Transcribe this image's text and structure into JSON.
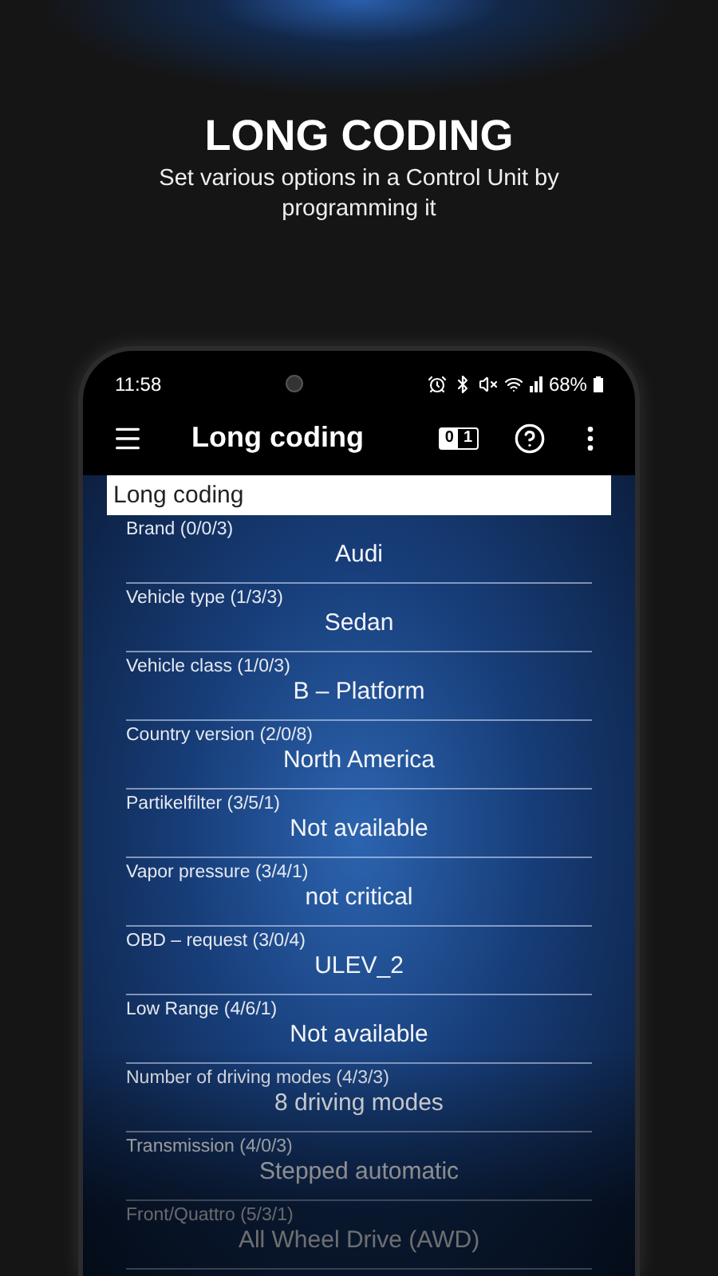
{
  "promo": {
    "title": "LONG CODING",
    "subtitle": "Set various options in a Control Unit by programming it"
  },
  "status_bar": {
    "time": "11:58",
    "battery": "68%"
  },
  "app_bar": {
    "title": "Long coding",
    "toggle_digits": [
      "0",
      "1"
    ]
  },
  "section": {
    "title": "Long coding"
  },
  "rows": [
    {
      "label": "Brand (0/0/3)",
      "value": "Audi"
    },
    {
      "label": "Vehicle type (1/3/3)",
      "value": "Sedan"
    },
    {
      "label": "Vehicle class (1/0/3)",
      "value": "B – Platform"
    },
    {
      "label": "Country version (2/0/8)",
      "value": "North America"
    },
    {
      "label": "Partikelfilter (3/5/1)",
      "value": "Not available"
    },
    {
      "label": "Vapor pressure (3/4/1)",
      "value": "not critical"
    },
    {
      "label": "OBD – request (3/0/4)",
      "value": "ULEV_2"
    },
    {
      "label": "Low Range (4/6/1)",
      "value": "Not available"
    },
    {
      "label": "Number of driving modes (4/3/3)",
      "value": "8 driving modes"
    },
    {
      "label": "Transmission (4/0/3)",
      "value": "Stepped automatic"
    },
    {
      "label": "Front/Quattro (5/3/1)",
      "value": "All Wheel Drive (AWD)"
    }
  ]
}
